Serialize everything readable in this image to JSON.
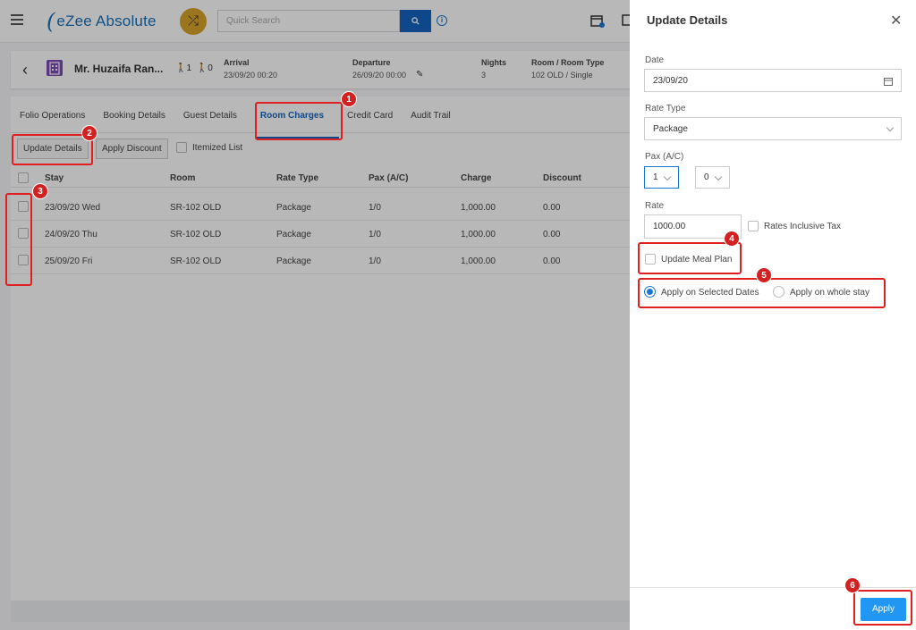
{
  "topbar": {
    "brand": "eZee Absolute",
    "search_placeholder": "Quick Search",
    "icons": [
      "menu-icon",
      "shuffle-icon",
      "search-icon",
      "info-icon",
      "calendar-icon"
    ]
  },
  "reservation": {
    "guest_name": "Mr. Huzaifa Ran...",
    "adults": "1",
    "children": "0",
    "arrival_label": "Arrival",
    "arrival_value": "23/09/20 00:20",
    "departure_label": "Departure",
    "departure_value": "26/09/20 00:00",
    "nights_label": "Nights",
    "nights_value": "3",
    "room_label": "Room / Room Type",
    "room_value": "102 OLD / Single"
  },
  "tabs": [
    "Folio Operations",
    "Booking Details",
    "Guest Details",
    "Room Charges",
    "Credit Card",
    "Audit Trail"
  ],
  "active_tab": "Room Charges",
  "actions": {
    "update_details": "Update Details",
    "apply_discount": "Apply Discount",
    "itemized_list": "Itemized List"
  },
  "table": {
    "columns": [
      "Stay",
      "Room",
      "Rate Type",
      "Pax (A/C)",
      "Charge",
      "Discount"
    ],
    "rows": [
      {
        "stay": "23/09/20 Wed",
        "room": "SR-102 OLD",
        "rate_type": "Package",
        "pax": "1/0",
        "charge": "1,000.00",
        "discount": "0.00"
      },
      {
        "stay": "24/09/20 Thu",
        "room": "SR-102 OLD",
        "rate_type": "Package",
        "pax": "1/0",
        "charge": "1,000.00",
        "discount": "0.00"
      },
      {
        "stay": "25/09/20 Fri",
        "room": "SR-102 OLD",
        "rate_type": "Package",
        "pax": "1/0",
        "charge": "1,000.00",
        "discount": "0.00"
      }
    ]
  },
  "drawer": {
    "title": "Update Details",
    "date_label": "Date",
    "date_value": "23/09/20",
    "rate_type_label": "Rate Type",
    "rate_type_value": "Package",
    "pax_label": "Pax (A/C)",
    "pax_adult": "1",
    "pax_child": "0",
    "rate_label": "Rate",
    "rate_value": "1000.00",
    "rates_inclusive_tax": "Rates Inclusive Tax",
    "update_meal_plan": "Update Meal Plan",
    "apply_selected": "Apply on Selected Dates",
    "apply_whole": "Apply on whole stay",
    "apply_button": "Apply"
  },
  "annotations": [
    "1",
    "2",
    "3",
    "4",
    "5",
    "6"
  ],
  "colors": {
    "brand": "#1b6fb8",
    "primary": "#1565c0",
    "apply": "#2196f3",
    "annotation": "#d32020"
  }
}
